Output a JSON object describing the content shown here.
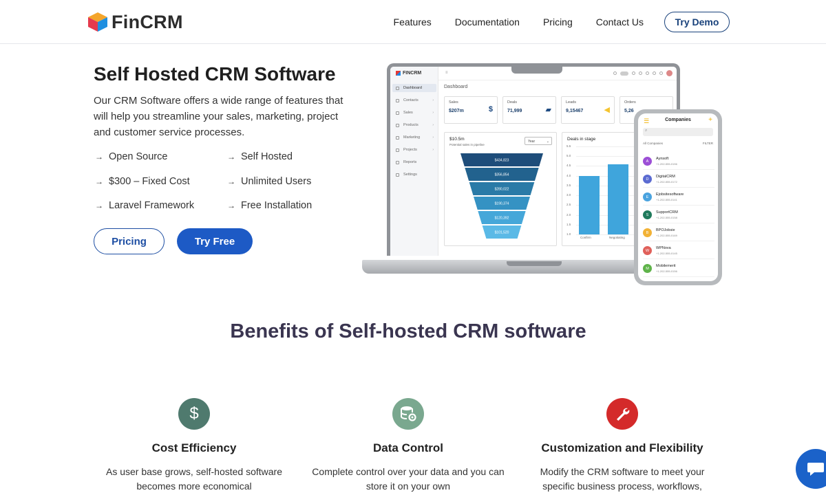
{
  "header": {
    "brand": "FinCRM",
    "nav": [
      "Features",
      "Documentation",
      "Pricing",
      "Contact Us"
    ],
    "demo_label": "Try Demo"
  },
  "hero": {
    "title": "Self Hosted CRM Software",
    "description": "Our CRM Software offers a wide range of features that will help you streamline your sales, marketing, project and customer service processes.",
    "features": [
      "Open Source",
      "Self Hosted",
      "$300 – Fixed Cost",
      "Unlimited Users",
      "Laravel Framework",
      "Free Installation"
    ],
    "pricing_label": "Pricing",
    "try_free_label": "Try Free"
  },
  "mockup": {
    "app_name": "FINCRM",
    "sidebar": [
      "Dashboard",
      "Contacts",
      "Sales",
      "Products",
      "Marketing",
      "Projects",
      "Reports",
      "Settings"
    ],
    "page_heading": "Dashboard",
    "kpis": [
      {
        "label": "Sales",
        "value": "$207m"
      },
      {
        "label": "Deals",
        "value": "71,999"
      },
      {
        "label": "Leads",
        "value": "9,15467"
      },
      {
        "label": "Orders",
        "value": "5,26"
      }
    ],
    "pipeline": {
      "title": "$10.5m",
      "subtitle": "Potential sales in pipeline",
      "period": "Year",
      "stages": [
        "$434,823",
        "$356,854",
        "$280,022",
        "$190,374",
        "$120,392",
        "$101,520"
      ]
    },
    "deals_chart": {
      "title": "Deals in stage",
      "yticks": [
        "5.5",
        "5.0",
        "4.5",
        "4.0",
        "3.5",
        "3.0",
        "2.5",
        "2.0",
        "1.5",
        "1.0"
      ],
      "xticks": [
        "Confirm",
        "Negotiating"
      ],
      "values": [
        4.0,
        4.6
      ],
      "ymin": 1.0,
      "ymax": 5.5
    },
    "phone": {
      "title": "Companies",
      "subtitle": "All Companies",
      "filter": "FILTER",
      "companies": [
        {
          "initial": "A",
          "name": "Aynsoft",
          "phone": "+1-202-555-0156",
          "color": "#9c4fd6"
        },
        {
          "initial": "D",
          "name": "DigitalCRM",
          "phone": "+1-202-555-0172",
          "color": "#5b6bd1"
        },
        {
          "initial": "E",
          "name": "Ejobsitesoftware",
          "phone": "+1-202-555-0141",
          "color": "#4aa3df"
        },
        {
          "initial": "S",
          "name": "SupportCRM",
          "phone": "+1-202-555-0158",
          "color": "#1f7a5c"
        },
        {
          "initial": "B",
          "name": "BPOJobsie",
          "phone": "+1-202-555-0169",
          "color": "#f2b236"
        },
        {
          "initial": "W",
          "name": "WPNova",
          "phone": "+1-202-555-0145",
          "color": "#e0605a"
        },
        {
          "initial": "M",
          "name": "Mobilemerit",
          "phone": "+1-202-555-0156",
          "color": "#5fb34a"
        }
      ]
    }
  },
  "benefits": {
    "title": "Benefits of Self-hosted CRM software",
    "items": [
      {
        "title": "Cost Efficiency",
        "text": "As user base grows, self-hosted software becomes more economical",
        "icon_glyph": "$",
        "color": "#4f7a6e"
      },
      {
        "title": "Data Control",
        "text": "Complete control over your data and you can store it on your own",
        "icon_glyph": "",
        "color": "#7aa88f"
      },
      {
        "title": "Customization and Flexibility",
        "text": "Modify the CRM software to meet your specific business process, workflows,",
        "icon_glyph": "",
        "color": "#d42a2a"
      }
    ]
  },
  "colors": {
    "primary": "#1d5ac5",
    "nav_outline": "#17407a",
    "funnel": [
      "#1e4d7a",
      "#22628e",
      "#2a7aa7",
      "#3592c3",
      "#45a7d9",
      "#5ab9e6"
    ],
    "bar": "#3fa5dc"
  }
}
